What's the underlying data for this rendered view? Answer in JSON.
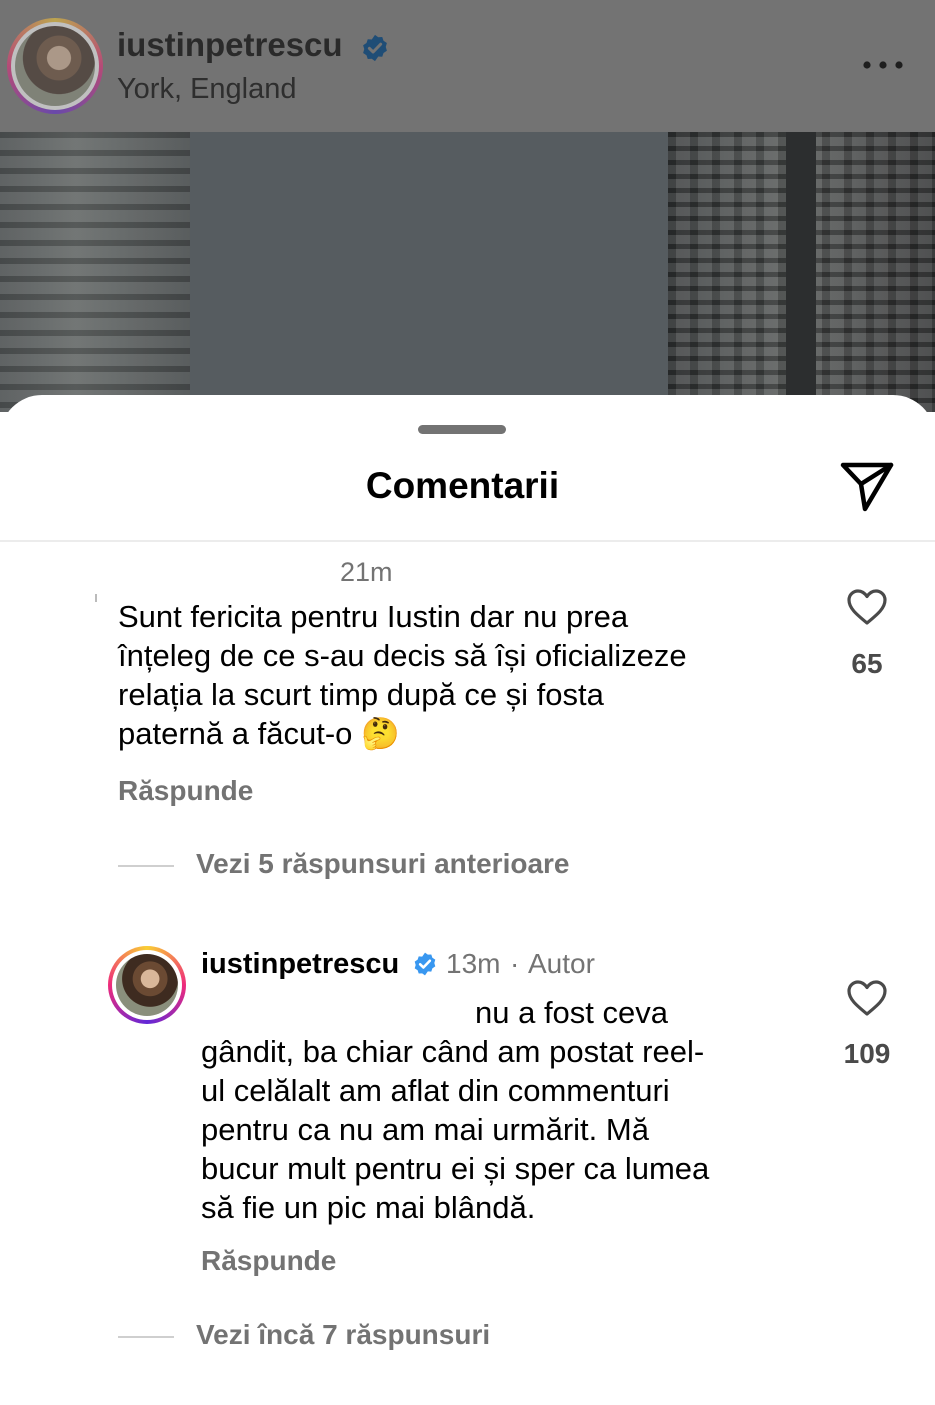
{
  "post_header": {
    "username": "iustinpetrescu",
    "location": "York, England"
  },
  "sheet": {
    "title": "Comentarii"
  },
  "comments": [
    {
      "time": "21m",
      "text": "Sunt fericita pentru Iustin dar nu prea\nînțeleg de ce s-au decis să își oficializeze\nrelația la scurt timp după ce și fosta\npaternă a făcut-o 🤔",
      "reply_label": "Răspunde",
      "likes": "65",
      "view_replies": "Vezi 5 răspunsuri anterioare"
    },
    {
      "username": "iustinpetrescu",
      "time": "13m",
      "separator": "·",
      "author_label": "Autor",
      "first_line": "nu a fost ceva",
      "text": "gândit, ba chiar când am postat reel-\nul celălalt am aflat din commenturi\npentru ca nu am mai urmărit. Mă\nbucur mult pentru ei și sper ca lumea\nsă fie un pic mai blândă.",
      "reply_label": "Răspunde",
      "likes": "109",
      "view_replies": "Vezi încă 7 răspunsuri"
    }
  ],
  "colors": {
    "verified_badge": "#3897f0",
    "secondary_text": "#737373",
    "dim_overlay": "#737373"
  },
  "icons": {
    "more": "more-horizontal-icon",
    "share": "paper-plane-icon",
    "like": "heart-outline-icon",
    "verified": "verified-badge-icon"
  }
}
